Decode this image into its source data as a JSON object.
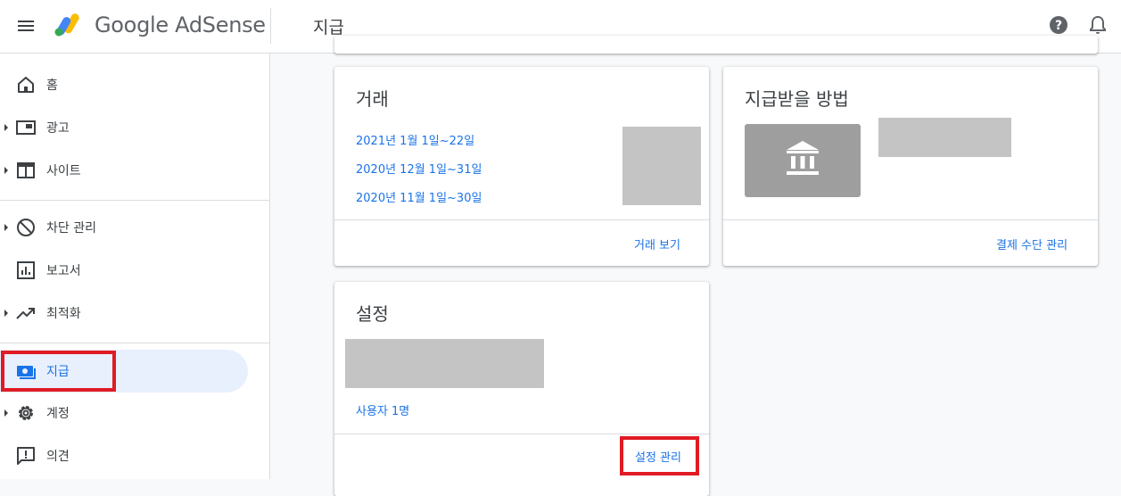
{
  "header": {
    "brand": "Google AdSense",
    "page_title": "지급"
  },
  "sidebar": {
    "items": [
      {
        "label": "홈",
        "icon": "home-icon"
      },
      {
        "label": "광고",
        "icon": "ads-icon"
      },
      {
        "label": "사이트",
        "icon": "sites-icon"
      },
      {
        "label": "차단 관리",
        "icon": "block-icon"
      },
      {
        "label": "보고서",
        "icon": "reports-icon"
      },
      {
        "label": "최적화",
        "icon": "trending-up-icon"
      },
      {
        "label": "지급",
        "icon": "payments-icon"
      },
      {
        "label": "계정",
        "icon": "gear-icon"
      },
      {
        "label": "의견",
        "icon": "feedback-icon"
      }
    ]
  },
  "transactions_card": {
    "title": "거래",
    "periods": [
      "2021년 1월 1일~22일",
      "2020년 12월 1일~31일",
      "2020년 11월 1일~30일"
    ],
    "action": "거래 보기"
  },
  "payment_method_card": {
    "title": "지급받을 방법",
    "action": "결제 수단 관리"
  },
  "settings_card": {
    "title": "설정",
    "users_link": "사용자 1명",
    "action": "설정 관리"
  },
  "colors": {
    "accent": "#1a73e8",
    "highlight": "#e01b24",
    "active_bg": "#e8f0fe"
  }
}
